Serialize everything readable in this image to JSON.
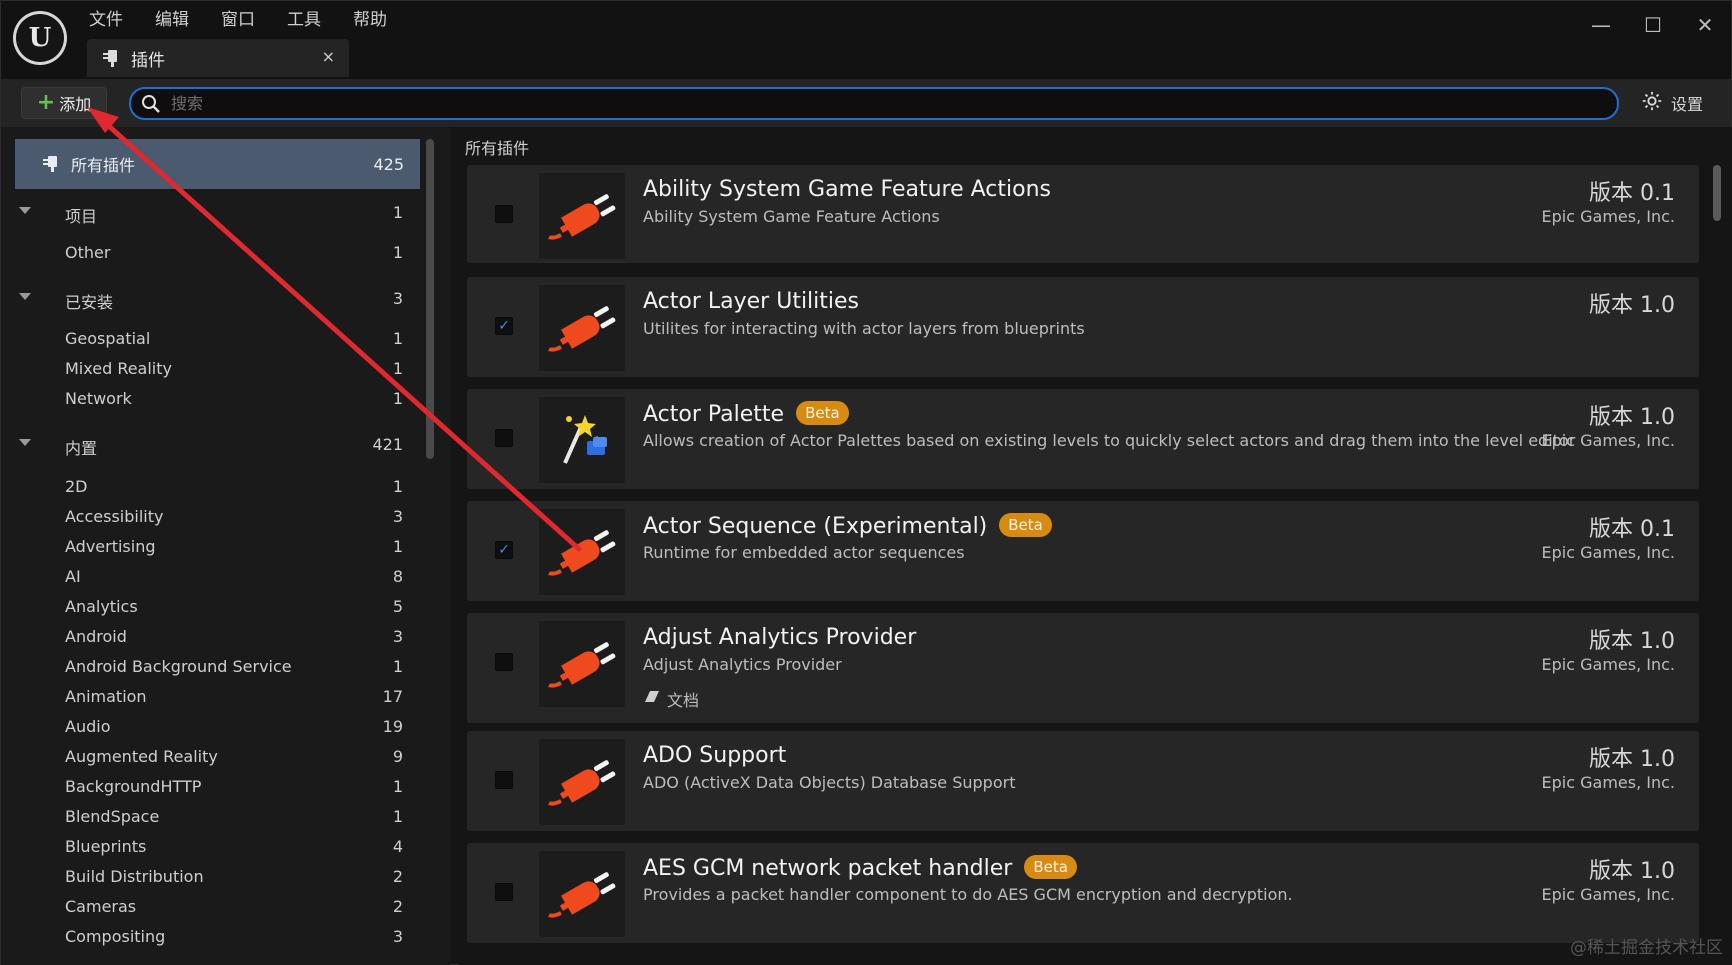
{
  "menubar": {
    "items": [
      "文件",
      "编辑",
      "窗口",
      "工具",
      "帮助"
    ]
  },
  "tab": {
    "label": "插件",
    "close": "×"
  },
  "window_controls": {
    "minimize": "—",
    "maximize": "☐",
    "close": "✕"
  },
  "toolbar": {
    "add_label": "添加",
    "search_placeholder": "搜索",
    "settings_label": "设置"
  },
  "sidebar": {
    "all": {
      "label": "所有插件",
      "count": "425"
    },
    "rows": [
      {
        "label": "项目",
        "count": "1",
        "group": true
      },
      {
        "label": "Other",
        "count": "1"
      },
      {
        "label": "已安装",
        "count": "3",
        "group": true
      },
      {
        "label": "Geospatial",
        "count": "1"
      },
      {
        "label": "Mixed Reality",
        "count": "1"
      },
      {
        "label": "Network",
        "count": "1"
      },
      {
        "label": "内置",
        "count": "421",
        "group": true
      },
      {
        "label": "2D",
        "count": "1"
      },
      {
        "label": "Accessibility",
        "count": "3"
      },
      {
        "label": "Advertising",
        "count": "1"
      },
      {
        "label": "AI",
        "count": "8"
      },
      {
        "label": "Analytics",
        "count": "5"
      },
      {
        "label": "Android",
        "count": "3"
      },
      {
        "label": "Android Background Service",
        "count": "1"
      },
      {
        "label": "Animation",
        "count": "17"
      },
      {
        "label": "Audio",
        "count": "19"
      },
      {
        "label": "Augmented Reality",
        "count": "9"
      },
      {
        "label": "BackgroundHTTP",
        "count": "1"
      },
      {
        "label": "BlendSpace",
        "count": "1"
      },
      {
        "label": "Blueprints",
        "count": "4"
      },
      {
        "label": "Build Distribution",
        "count": "2"
      },
      {
        "label": "Cameras",
        "count": "2"
      },
      {
        "label": "Compositing",
        "count": "3"
      }
    ]
  },
  "main": {
    "header": "所有插件",
    "plugins": [
      {
        "name": "Ability System Game Feature Actions",
        "beta": false,
        "desc": "Ability System Game Feature Actions",
        "version": "版本 0.1",
        "vendor": "Epic Games, Inc.",
        "checked": false,
        "icon": "plug-icon"
      },
      {
        "name": "Actor Layer Utilities",
        "beta": false,
        "desc": "Utilites for interacting with actor layers from blueprints",
        "version": "版本 1.0",
        "vendor": "",
        "checked": true,
        "icon": "plug-icon"
      },
      {
        "name": "Actor Palette",
        "beta": true,
        "desc": "Allows creation of Actor Palettes based on existing levels to quickly select actors and drag them into the level editor",
        "version": "版本 1.0",
        "vendor": "Epic Games, Inc.",
        "checked": false,
        "icon": "magic-wand-icon"
      },
      {
        "name": "Actor Sequence (Experimental)",
        "beta": true,
        "desc": "Runtime for embedded actor sequences",
        "version": "版本 0.1",
        "vendor": "Epic Games, Inc.",
        "checked": true,
        "icon": "plug-icon"
      },
      {
        "name": "Adjust Analytics Provider",
        "beta": false,
        "desc": "Adjust Analytics Provider",
        "version": "版本 1.0",
        "vendor": "Epic Games, Inc.",
        "checked": false,
        "icon": "plug-icon",
        "doc": "文档"
      },
      {
        "name": "ADO Support",
        "beta": false,
        "desc": "ADO (ActiveX Data Objects) Database Support",
        "version": "版本 1.0",
        "vendor": "Epic Games, Inc.",
        "checked": false,
        "icon": "plug-icon"
      },
      {
        "name": "AES GCM network packet handler",
        "beta": true,
        "desc": "Provides a packet handler component to do AES GCM encryption and decryption.",
        "version": "版本 1.0",
        "vendor": "Epic Games, Inc.",
        "checked": false,
        "icon": "plug-icon"
      }
    ],
    "beta_label": "Beta"
  },
  "annotation": {
    "arrow_color": "#e0282e"
  },
  "watermark": "@稀土掘金技术社区"
}
